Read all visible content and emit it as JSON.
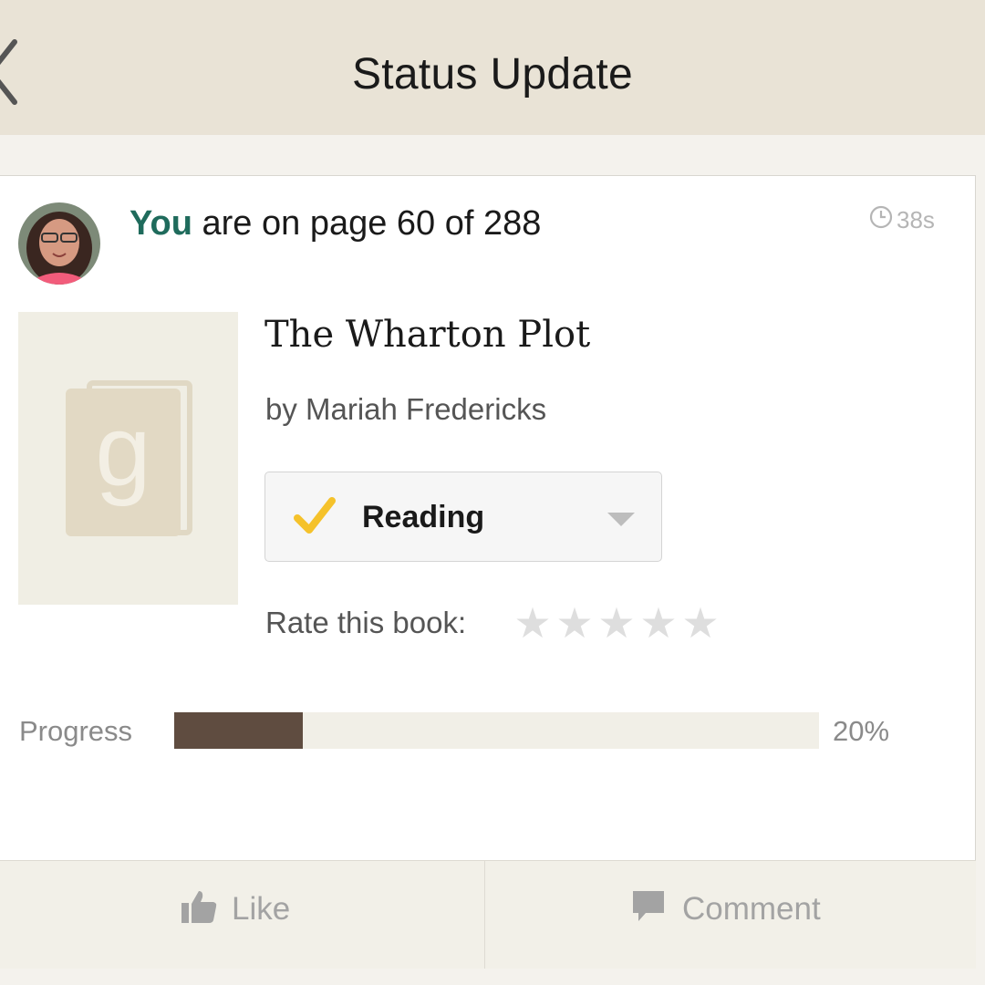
{
  "nav": {
    "title": "Status Update",
    "back_icon": "chevron-left-icon"
  },
  "update": {
    "actor": "You",
    "text": "are on page 60 of 288",
    "timestamp": "38s",
    "current_page": 60,
    "total_pages": 288
  },
  "book": {
    "title": "The Wharton Plot",
    "author_line": "by Mariah Fredericks",
    "cover_icon": "goodreads-book-placeholder-icon",
    "cover_letter": "g"
  },
  "shelf": {
    "label": "Reading",
    "icon": "checkmark-icon",
    "dropdown_icon": "caret-down-icon"
  },
  "rating": {
    "label": "Rate this book:",
    "stars_total": 5,
    "stars_filled": 0
  },
  "progress": {
    "label": "Progress",
    "value_text": "20%",
    "fraction": 0.2
  },
  "actions": {
    "like_label": "Like",
    "comment_label": "Comment"
  },
  "colors": {
    "nav_background": "#e9e3d6",
    "actor_link": "#1f6b5c",
    "check_accent": "#f5c22b",
    "progress_fill": "#5f4c40",
    "progress_track": "#f1efe7",
    "action_bar": "#f2f0e8"
  }
}
